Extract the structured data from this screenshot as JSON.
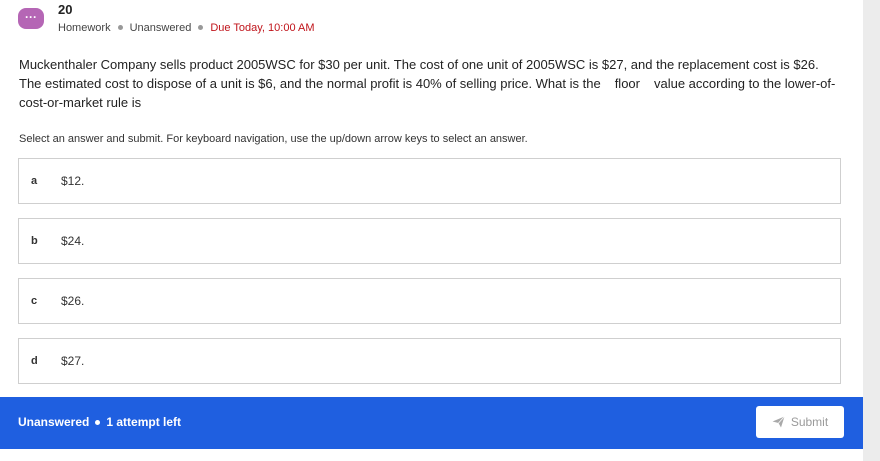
{
  "header": {
    "icon": "chat-bubble-icon",
    "icon_glyph": "···",
    "question_number": "20",
    "type": "Homework",
    "status": "Unanswered",
    "due": "Due Today, 10:00 AM",
    "due_color": "#c0141b"
  },
  "question": {
    "part1": "Muckenthaler Company sells product 2005WSC for $30 per unit. The cost of one unit of 2005WSC is $27, and the replacement cost is $26. The estimated cost to dispose of a unit is $6, and the normal profit is 40% of selling price. What is the",
    "blank_word": "floor",
    "part2": "value according to the lower-of-cost-or-market rule is"
  },
  "instructions": "Select an answer and submit. For keyboard navigation, use the up/down arrow keys to select an answer.",
  "options": [
    {
      "letter": "a",
      "text": "$12."
    },
    {
      "letter": "b",
      "text": "$24."
    },
    {
      "letter": "c",
      "text": "$26."
    },
    {
      "letter": "d",
      "text": "$27."
    }
  ],
  "footer": {
    "status": "Unanswered",
    "attempts": "1 attempt left",
    "submit_label": "Submit",
    "submit_icon": "send-icon",
    "background_color": "#1f5fe0"
  }
}
